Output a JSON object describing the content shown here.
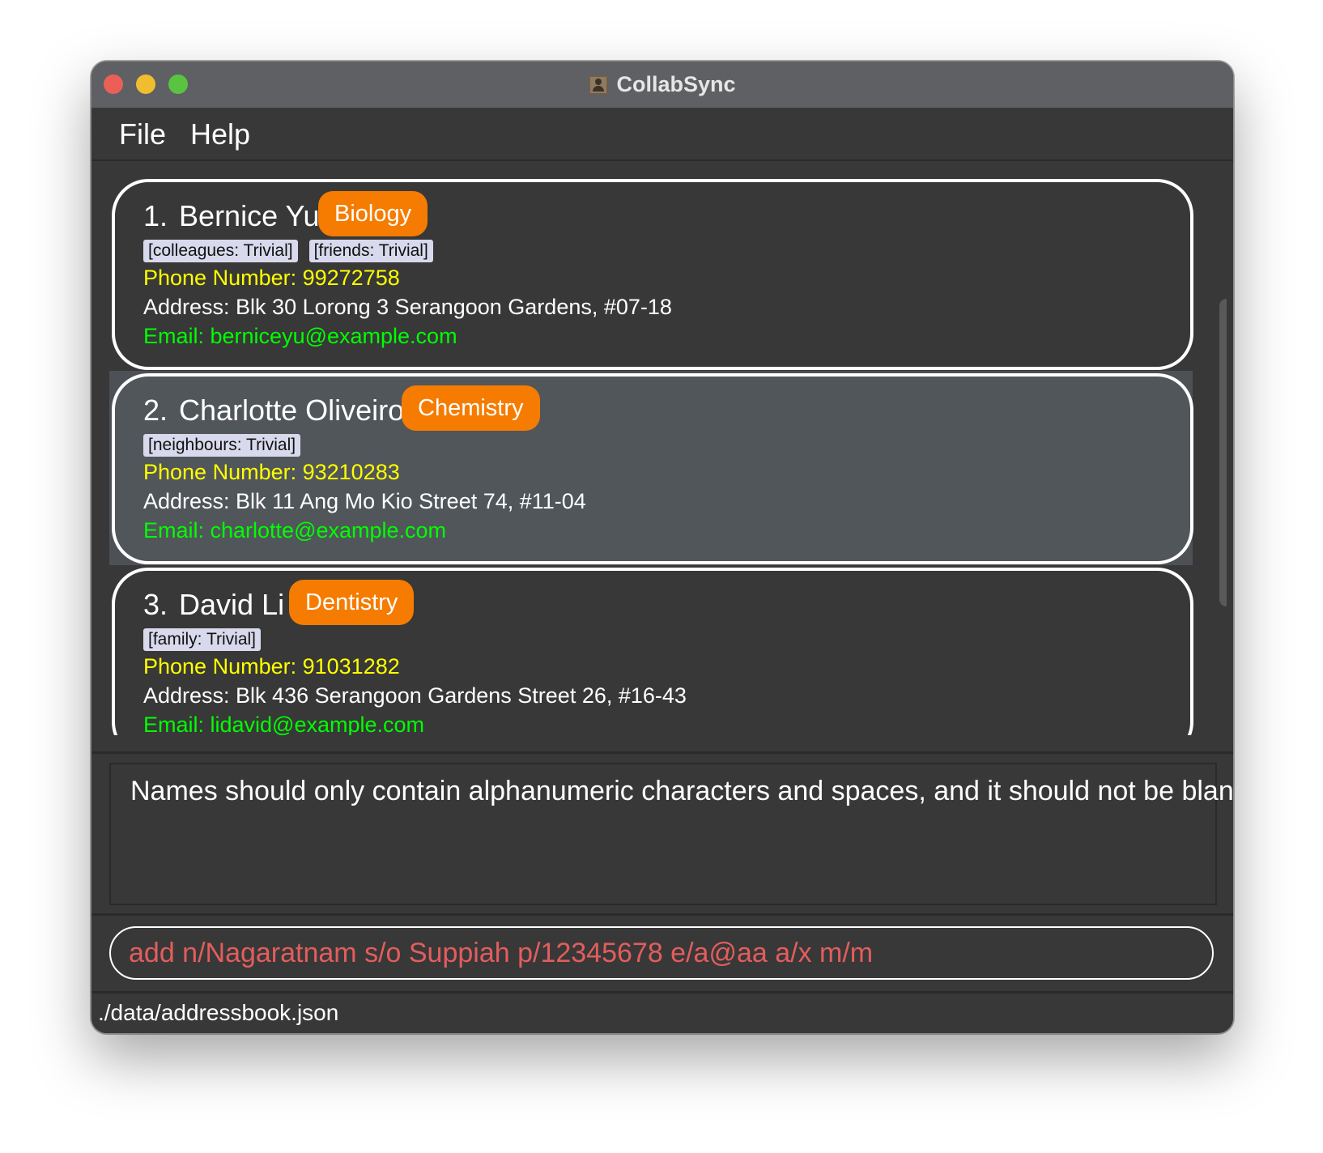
{
  "window": {
    "title": "CollabSync"
  },
  "menu": {
    "file": "File",
    "help": "Help"
  },
  "persons": [
    {
      "index": "1.",
      "name": "Bernice Yu",
      "major": "Biology",
      "tags": [
        "[colleagues: Trivial]",
        "[friends: Trivial]"
      ],
      "phone": "Phone Number: 99272758",
      "address": "Address: Blk 30 Lorong 3 Serangoon Gardens, #07-18",
      "email": "Email: berniceyu@example.com",
      "selected": false
    },
    {
      "index": "2.",
      "name": "Charlotte Oliveiro",
      "major": "Chemistry",
      "tags": [
        "[neighbours: Trivial]"
      ],
      "phone": "Phone Number: 93210283",
      "address": "Address: Blk 11 Ang Mo Kio Street 74, #11-04",
      "email": "Email: charlotte@example.com",
      "selected": true
    },
    {
      "index": "3.",
      "name": "David Li",
      "major": "Dentistry",
      "tags": [
        "[family: Trivial]"
      ],
      "phone": "Phone Number: 91031282",
      "address": "Address: Blk 436 Serangoon Gardens Street 26, #16-43",
      "email": "Email: lidavid@example.com",
      "selected": false
    }
  ],
  "result": {
    "message": "Names should only contain alphanumeric characters and spaces, and it should not be blank"
  },
  "command": {
    "value": "add n/Nagaratnam s/o Suppiah p/12345678 e/a@aa a/x m/m"
  },
  "status": {
    "path": "./data/addressbook.json"
  },
  "colors": {
    "accent_badge": "#f57c00",
    "phone": "#ffff00",
    "email": "#00ff00",
    "error_command": "#e35d5d",
    "background": "#383838"
  }
}
